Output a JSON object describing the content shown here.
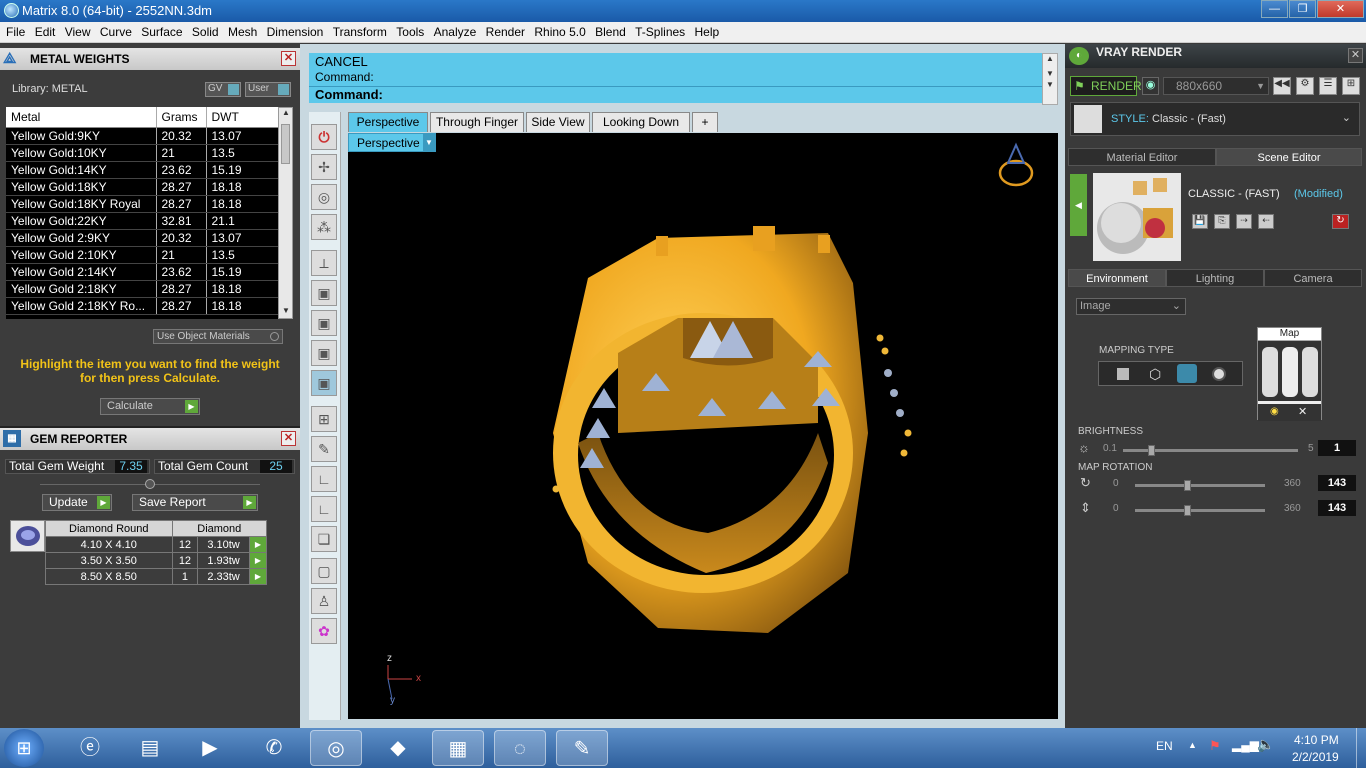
{
  "window": {
    "title": "Matrix 8.0 (64-bit) - 2552NN.3dm",
    "minimize": "—",
    "maximize": "❐",
    "close": "✕"
  },
  "menu": [
    "File",
    "Edit",
    "View",
    "Curve",
    "Surface",
    "Solid",
    "Mesh",
    "Dimension",
    "Transform",
    "Tools",
    "Analyze",
    "Render",
    "Rhino 5.0",
    "Blend",
    "T-Splines",
    "Help"
  ],
  "metal_weights": {
    "title": "METAL WEIGHTS",
    "library_label": "Library: METAL",
    "gv": "GV",
    "user": "User",
    "columns": [
      "Metal",
      "Grams",
      "DWT"
    ],
    "rows": [
      [
        "Yellow Gold:9KY",
        "20.32",
        "13.07"
      ],
      [
        "Yellow Gold:10KY",
        "21",
        "13.5"
      ],
      [
        "Yellow Gold:14KY",
        "23.62",
        "15.19"
      ],
      [
        "Yellow Gold:18KY",
        "28.27",
        "18.18"
      ],
      [
        "Yellow Gold:18KY Royal",
        "28.27",
        "18.18"
      ],
      [
        "Yellow Gold:22KY",
        "32.81",
        "21.1"
      ],
      [
        "Yellow Gold 2:9KY",
        "20.32",
        "13.07"
      ],
      [
        "Yellow Gold 2:10KY",
        "21",
        "13.5"
      ],
      [
        "Yellow Gold 2:14KY",
        "23.62",
        "15.19"
      ],
      [
        "Yellow Gold 2:18KY",
        "28.27",
        "18.18"
      ],
      [
        "Yellow Gold 2:18KY Ro...",
        "28.27",
        "18.18"
      ]
    ],
    "use_object_materials": "Use Object Materials",
    "hint": "Highlight the item you want to find the weight for then press Calculate.",
    "calculate": "Calculate"
  },
  "gem_reporter": {
    "title": "GEM REPORTER",
    "total_weight_label": "Total Gem Weight",
    "total_weight": "7.35",
    "total_count_label": "Total Gem Count",
    "total_count": "25",
    "update": "Update",
    "save_report": "Save Report",
    "columns": [
      "Diamond Round",
      "Diamond"
    ],
    "rows": [
      [
        "4.10 X 4.10",
        "12",
        "3.10tw"
      ],
      [
        "3.50 X 3.50",
        "12",
        "1.93tw"
      ],
      [
        "8.50 X 8.50",
        "1",
        "2.33tw"
      ]
    ]
  },
  "command": {
    "line1": "CANCEL",
    "line2": "Command:",
    "prompt": "Command:"
  },
  "viewport_tabs": [
    "Perspective",
    "Through Finger",
    "Side View",
    "Looking Down",
    "+"
  ],
  "viewport_label": "Perspective",
  "axes": {
    "z": "z",
    "x": "x",
    "y": "y"
  },
  "vray": {
    "title": "VRAY RENDER",
    "render": "RENDER",
    "resolution": "880x660",
    "style_label": "STYLE:",
    "style_value": "Classic - (Fast)",
    "tabs": [
      "Material Editor",
      "Scene Editor"
    ],
    "preset_name": "CLASSIC - (FAST)",
    "preset_state": "(Modified)",
    "env_tabs": [
      "Environment",
      "Lighting",
      "Camera"
    ],
    "image_select": "Image",
    "mapping_type": "MAPPING TYPE",
    "map_label": "Map",
    "brightness_label": "BRIGHTNESS",
    "brightness_min": "0.1",
    "brightness_max": "5",
    "brightness_value": "1",
    "brightness_level": 0.16,
    "rotation_label": "MAP ROTATION",
    "rot1_min": "0",
    "rot1_max": "360",
    "rot1_value": "143",
    "rot1_level": 0.4,
    "rot2_min": "0",
    "rot2_max": "360",
    "rot2_value": "143",
    "rot2_level": 0.4
  },
  "tray": {
    "lang": "EN",
    "time": "4:10 PM",
    "date": "2/2/2019"
  },
  "colors": {
    "accent": "#5cc8ea",
    "gold": "#f0a820",
    "hint": "#f2c318"
  }
}
